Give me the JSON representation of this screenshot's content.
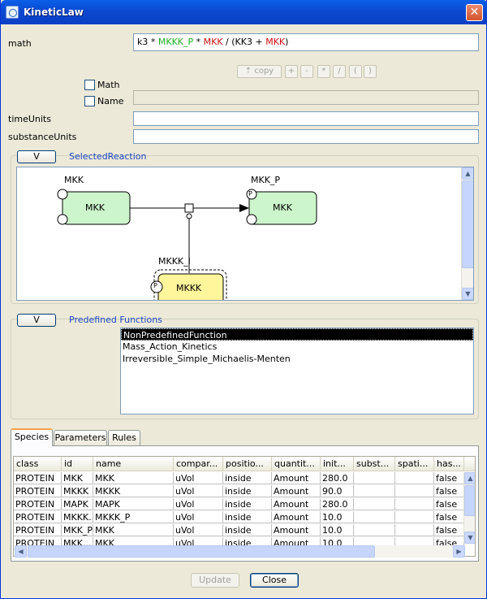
{
  "window": {
    "title": "KineticLaw",
    "close_glyph": "✕"
  },
  "math": {
    "label": "math",
    "expression": [
      {
        "text": "k3",
        "color": "#000000"
      },
      {
        "text": " * ",
        "color": "#000000"
      },
      {
        "text": "MKKK_P",
        "color": "#20b020"
      },
      {
        "text": " * ",
        "color": "#000000"
      },
      {
        "text": "MKK",
        "color": "#d01010"
      },
      {
        "text": " / (KK3 + ",
        "color": "#000000"
      },
      {
        "text": "MKK",
        "color": "#d01010"
      },
      {
        "text": ")",
        "color": "#000000"
      }
    ],
    "toolbar": {
      "copy_label": "copy",
      "plus": "+",
      "minus": "-",
      "multiply": "*",
      "divide": "/",
      "lparen": "(",
      "rparen": ")"
    },
    "checkbox_math": "Math",
    "checkbox_name": "Name"
  },
  "fields": {
    "time_units_label": "timeUnits",
    "substance_units_label": "substanceUnits"
  },
  "selected_reaction": {
    "toggle_label": "V",
    "title": "SelectedReaction",
    "nodes": {
      "mkk_label": "MKK",
      "mkk_text": "MKK",
      "mkkp_label": "MKK_P",
      "mkkp_text": "MKK",
      "mkkk_label": "MKKK_I",
      "mkkk_text": "MKKK",
      "p_glyph": "P"
    }
  },
  "predefined": {
    "toggle_label": "V",
    "title": "Predefined Functions",
    "items": [
      "NonPredefinedFunction",
      "Mass_Action_Kinetics",
      "Irreversible_Simple_Michaelis-Menten"
    ]
  },
  "tabs": [
    "Species",
    "Parameters",
    "Rules"
  ],
  "table": {
    "headers": [
      "class",
      "id",
      "name",
      "compar...",
      "positio...",
      "quantit...",
      "init...",
      "subst...",
      "spati...",
      "has..."
    ],
    "rows": [
      [
        "PROTEIN",
        "MKK",
        "MKK",
        "uVol",
        "inside",
        "Amount",
        "280.0",
        "",
        "",
        "false"
      ],
      [
        "PROTEIN",
        "MKKK",
        "MKKK",
        "uVol",
        "inside",
        "Amount",
        "90.0",
        "",
        "",
        "false"
      ],
      [
        "PROTEIN",
        "MAPK",
        "MAPK",
        "uVol",
        "inside",
        "Amount",
        "280.0",
        "",
        "",
        "false"
      ],
      [
        "PROTEIN",
        "MKKK...",
        "MKKK_P",
        "uVol",
        "inside",
        "Amount",
        "10.0",
        "",
        "",
        "false"
      ],
      [
        "PROTEIN",
        "MKK_P",
        "MKK",
        "uVol",
        "inside",
        "Amount",
        "10.0",
        "",
        "",
        "false"
      ],
      [
        "PROTEIN",
        "MKK...",
        "MKK",
        "uVol",
        "inside",
        "Amount",
        "10.0",
        "",
        "",
        "false"
      ]
    ]
  },
  "buttons": {
    "update": "Update",
    "close": "Close"
  }
}
